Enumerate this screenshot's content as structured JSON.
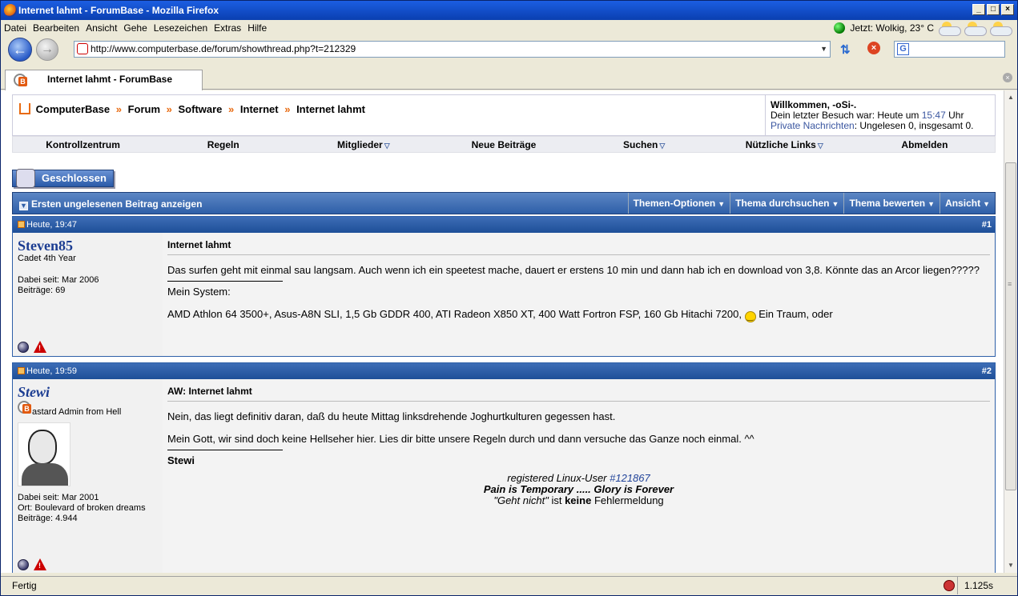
{
  "window": {
    "title": "Internet lahmt - ForumBase - Mozilla Firefox"
  },
  "menu": {
    "items": [
      "Datei",
      "Bearbeiten",
      "Ansicht",
      "Gehe",
      "Lesezeichen",
      "Extras",
      "Hilfe"
    ]
  },
  "weather": {
    "text": "Jetzt: Wolkig, 23° C"
  },
  "nav": {
    "url": "http://www.computerbase.de/forum/showthread.php?t=212329"
  },
  "tab": {
    "label": "Internet lahmt - ForumBase"
  },
  "breadcrumb": {
    "items": [
      "ComputerBase",
      "Forum",
      "Software",
      "Internet",
      "Internet lahmt"
    ],
    "separator": "»"
  },
  "welcome": {
    "heading": "Willkommen, -oSi-.",
    "last_visit_prefix": "Dein letzter Besuch war: Heute um ",
    "last_visit_time": "15:47",
    "last_visit_suffix": " Uhr",
    "pm_link": "Private Nachrichten",
    "pm_status": ": Ungelesen 0, insgesamt 0."
  },
  "forumnav": {
    "items": [
      "Kontrollzentrum",
      "Regeln",
      "Mitglieder",
      "Neue Beiträge",
      "Suchen",
      "Nützliche Links",
      "Abmelden"
    ]
  },
  "closed_label": "Geschlossen",
  "threadbar": {
    "first_unread": "Ersten ungelesenen Beitrag anzeigen",
    "options": [
      "Themen-Optionen",
      "Thema durchsuchen",
      "Thema bewerten",
      "Ansicht"
    ]
  },
  "posts": [
    {
      "date": "Heute, 19:47",
      "number": "#1",
      "username": "Steven85",
      "user_title": "Cadet 4th Year",
      "joined": "Dabei seit: Mar 2006",
      "posts": "Beiträge: 69",
      "title": "Internet lahmt",
      "body": "Das surfen geht mit einmal sau langsam. Auch wenn ich ein speetest mache, dauert er erstens 10 min und dann hab ich en download von 3,8. Könnte das an Arcor liegen?????",
      "sig_label": "Mein System:",
      "sig_text_1": "AMD Athlon 64 3500+, Asus-A8N SLI, 1,5 Gb GDDR 400, ATI Radeon X850 XT, 400 Watt Fortron FSP, 160 Gb Hitachi 7200,",
      "sig_text_2": "Ein Traum, oder"
    },
    {
      "date": "Heute, 19:59",
      "number": "#2",
      "username": "Stewi",
      "user_title": "astard Admin from Hell",
      "joined": "Dabei seit: Mar 2001",
      "location": "Ort: Boulevard of broken dreams",
      "posts": "Beiträge: 4.944",
      "title": "AW: Internet lahmt",
      "body_1": "Nein, das liegt definitiv daran, daß du heute Mittag linksdrehende Joghurtkulturen gegessen hast.",
      "body_2": "Mein Gott, wir sind doch keine Hellseher hier. Lies dir bitte unsere Regeln durch und dann versuche das Ganze noch einmal. ^^",
      "sig_name": "Stewi",
      "sig_linux_prefix": "registered Linux-User ",
      "sig_linux_id": "#121867",
      "sig_pain": "Pain is Temporary ..... Glory is Forever",
      "sig_geht": "\"Geht nicht\"",
      "sig_ist": " ist ",
      "sig_keine": "keine",
      "sig_fehler": " Fehlermeldung"
    }
  ],
  "status": {
    "left": "Fertig",
    "right": "1.125s"
  }
}
